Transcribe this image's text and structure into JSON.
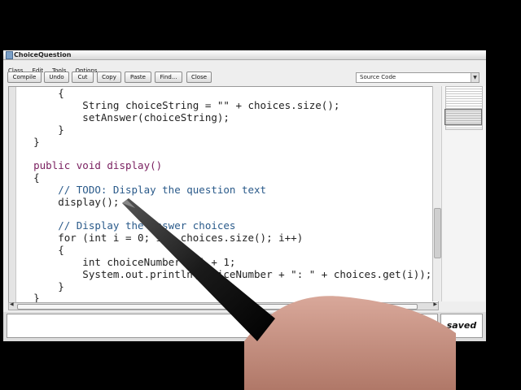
{
  "window": {
    "title": "ChoiceQuestion"
  },
  "menu": [
    "Class",
    "Edit",
    "Tools",
    "Options"
  ],
  "toolbar": {
    "buttons": [
      "Compile",
      "Undo",
      "Cut",
      "Copy",
      "Paste",
      "Find...",
      "Close"
    ],
    "view_select": "Source Code"
  },
  "code": {
    "lines": [
      "        {",
      "            String choiceString = \"\" + choices.size();",
      "            setAnswer(choiceString);",
      "        }",
      "    }",
      "",
      "    public void display()",
      "    {",
      "        // TODO: Display the question text",
      "        display();",
      "",
      "        // Display the answer choices",
      "        for (int i = 0; i < choices.size(); i++)",
      "        {",
      "            int choiceNumber = i + 1;",
      "            System.out.println(choiceNumber + \": \" + choices.get(i));",
      "        }",
      "    }"
    ]
  },
  "status": {
    "message": "",
    "saved_label": "saved"
  }
}
